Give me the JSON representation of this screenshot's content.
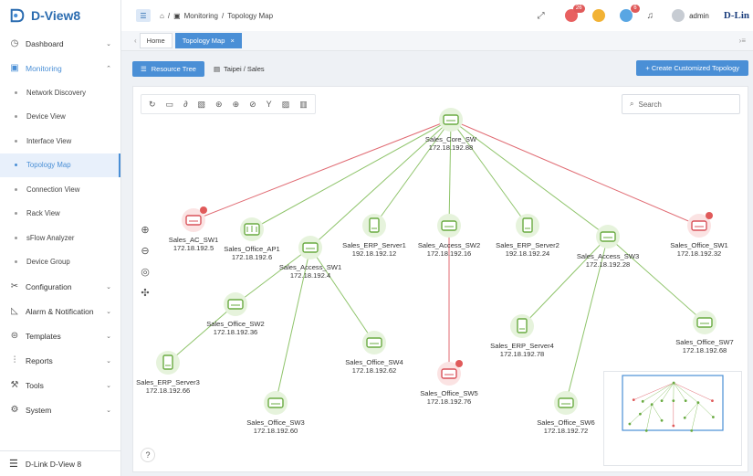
{
  "app": {
    "logo_text": "D-View8",
    "brand": "D-Lin"
  },
  "sidebar": {
    "items": [
      {
        "label": "Dashboard",
        "icon": "dashboard-icon",
        "expandable": true
      },
      {
        "label": "Monitoring",
        "icon": "monitor-icon",
        "expandable": true,
        "expanded": true
      }
    ],
    "monitoring_subitems": [
      {
        "label": "Network Discovery"
      },
      {
        "label": "Device View"
      },
      {
        "label": "Interface View"
      },
      {
        "label": "Topology Map",
        "active": true
      },
      {
        "label": "Connection View"
      },
      {
        "label": "Rack View"
      },
      {
        "label": "sFlow Analyzer"
      },
      {
        "label": "Device Group"
      }
    ],
    "groups": [
      {
        "label": "Configuration",
        "icon": "config-icon"
      },
      {
        "label": "Alarm & Notification",
        "icon": "alarm-icon"
      },
      {
        "label": "Templates",
        "icon": "templates-icon"
      },
      {
        "label": "Reports",
        "icon": "reports-icon"
      },
      {
        "label": "Tools",
        "icon": "tools-icon"
      },
      {
        "label": "System",
        "icon": "system-icon"
      }
    ],
    "footer_label": "D-Link D-View 8"
  },
  "topbar": {
    "breadcrumb_monitoring": "Monitoring",
    "breadcrumb_sep": "/",
    "breadcrumb_page": "Topology Map",
    "notif_badges": [
      "26",
      "",
      "6",
      ""
    ],
    "user": "admin"
  },
  "tabs": {
    "home": "Home",
    "topology": "Topology Map"
  },
  "toolbar": {
    "resource_tree": "Resource Tree",
    "path": "Taipei / Sales",
    "create_button": "+ Create Customized Topology",
    "search_placeholder": "Search"
  },
  "topology": {
    "nodes": [
      {
        "id": "core",
        "name": "Sales_Core_SW",
        "ip": "172.18.192.88",
        "type": "switch",
        "alarm": false
      },
      {
        "id": "ac1",
        "name": "Sales_AC_SW1",
        "ip": "172.18.192.5",
        "type": "switch",
        "alarm": true
      },
      {
        "id": "ap1",
        "name": "Sales_Office_AP1",
        "ip": "172.18.192.6",
        "type": "ap",
        "alarm": false
      },
      {
        "id": "acc1",
        "name": "Sales_Access_SW1",
        "ip": "172.18.192.4",
        "type": "switch",
        "alarm": false
      },
      {
        "id": "erp1",
        "name": "Sales_ERP_Server1",
        "ip": "192.18.192.12",
        "type": "server",
        "alarm": false
      },
      {
        "id": "acc2",
        "name": "Sales_Access_SW2",
        "ip": "172.18.192.16",
        "type": "switch",
        "alarm": false
      },
      {
        "id": "erp2",
        "name": "Sales_ERP_Server2",
        "ip": "192.18.192.24",
        "type": "server",
        "alarm": false
      },
      {
        "id": "acc3",
        "name": "Sales_Access_SW3",
        "ip": "172.18.192.28",
        "type": "switch",
        "alarm": false
      },
      {
        "id": "osw1",
        "name": "Sales_Office_SW1",
        "ip": "172.18.192.32",
        "type": "switch",
        "alarm": true
      },
      {
        "id": "osw2",
        "name": "Sales_Office_SW2",
        "ip": "172.18.192.36",
        "type": "switch",
        "alarm": false
      },
      {
        "id": "erp3",
        "name": "Sales_ERP_Server3",
        "ip": "172.18.192.66",
        "type": "server",
        "alarm": false
      },
      {
        "id": "osw3",
        "name": "Sales_Office_SW3",
        "ip": "172.18.192.60",
        "type": "switch",
        "alarm": false
      },
      {
        "id": "osw4",
        "name": "Sales_Office_SW4",
        "ip": "172.18.192.62",
        "type": "switch",
        "alarm": false
      },
      {
        "id": "osw5",
        "name": "Sales_Office_SW5",
        "ip": "172.18.192.76",
        "type": "switch",
        "alarm": true
      },
      {
        "id": "erp4",
        "name": "Sales_ERP_Server4",
        "ip": "172.18.192.78",
        "type": "server",
        "alarm": false
      },
      {
        "id": "osw6",
        "name": "Sales_Office_SW6",
        "ip": "172.18.192.72",
        "type": "switch",
        "alarm": false
      },
      {
        "id": "osw7",
        "name": "Sales_Office_SW7",
        "ip": "172.18.192.68",
        "type": "switch",
        "alarm": false
      }
    ],
    "links": [
      {
        "from": "core",
        "to": "ac1",
        "status": "down"
      },
      {
        "from": "core",
        "to": "ap1",
        "status": "up"
      },
      {
        "from": "core",
        "to": "acc1",
        "status": "up"
      },
      {
        "from": "core",
        "to": "erp1",
        "status": "up"
      },
      {
        "from": "core",
        "to": "acc2",
        "status": "up"
      },
      {
        "from": "core",
        "to": "erp2",
        "status": "up"
      },
      {
        "from": "core",
        "to": "acc3",
        "status": "up"
      },
      {
        "from": "core",
        "to": "osw1",
        "status": "down"
      },
      {
        "from": "acc1",
        "to": "osw2",
        "status": "up"
      },
      {
        "from": "acc1",
        "to": "osw3",
        "status": "up"
      },
      {
        "from": "acc1",
        "to": "osw4",
        "status": "up"
      },
      {
        "from": "osw2",
        "to": "erp3",
        "status": "up"
      },
      {
        "from": "acc2",
        "to": "osw5",
        "status": "down"
      },
      {
        "from": "acc3",
        "to": "erp4",
        "status": "up"
      },
      {
        "from": "acc3",
        "to": "osw6",
        "status": "up"
      },
      {
        "from": "acc3",
        "to": "osw7",
        "status": "up"
      }
    ]
  },
  "colors": {
    "accent": "#4a8fd6",
    "link_up": "#8fc46b",
    "link_down": "#e06a72",
    "alarm": "#e05a5a"
  }
}
